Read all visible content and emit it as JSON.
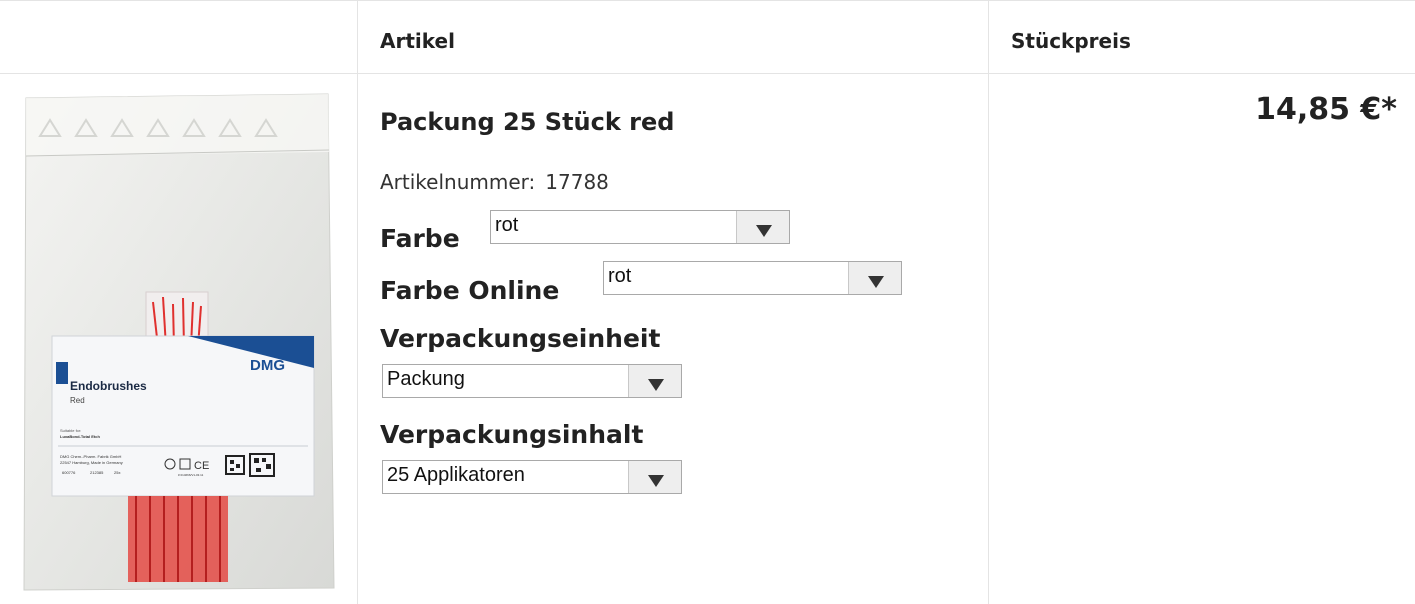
{
  "header": {
    "col_article": "Artikel",
    "col_unit_price": "Stückpreis"
  },
  "product": {
    "image_alt": "Endobrushes Red",
    "title": "Packung 25 Stück red",
    "article_number_label": "Artikelnummer:",
    "article_number": "17788",
    "price": "14,85 €*",
    "options": {
      "farbe": {
        "label": "Farbe",
        "value": "rot"
      },
      "farbe_online": {
        "label": "Farbe Online",
        "value": "rot"
      },
      "verpackungseinheit": {
        "label": "Verpackungseinheit",
        "value": "Packung"
      },
      "verpackungsinhalt": {
        "label": "Verpackungsinhalt",
        "value": "25 Applikatoren"
      }
    }
  },
  "package_print": {
    "brand": "DMG",
    "product_name": "Endobrushes",
    "variant": "Red",
    "suitable_for_label": "Suitable for:",
    "suitable_for": "LuxaBond-Total Etch",
    "manufacturer": "DMG Chem.-Pharm. Fabrik GmbH",
    "address": "22547 Hamburg, Made in Germany",
    "lot": "600776",
    "ref": "212385",
    "count": "25x",
    "code": "# 014666/V1-03.11"
  },
  "colors": {
    "grid": "#e4e4e4",
    "brand_blue": "#1b4f94",
    "brush_red": "#e0302e"
  }
}
